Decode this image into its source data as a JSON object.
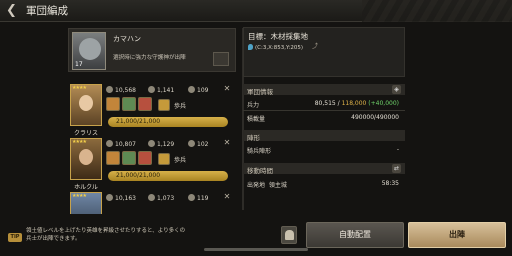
{
  "header": {
    "title": "軍団編成",
    "back_icon": "back-arrow-icon"
  },
  "commander": {
    "name": "カマハン",
    "level": "17",
    "description": "選択時に強力な守護神が出陣"
  },
  "heroes": [
    {
      "name": "クラリス",
      "stars": "★★★★",
      "troops": "10,568",
      "attack": "1,141",
      "count": "109",
      "unit_type": "歩兵",
      "power": "21,000/21,000",
      "power_fill": 1.0
    },
    {
      "name": "ホルクル",
      "stars": "★★★★",
      "troops": "10,807",
      "attack": "1,129",
      "count": "102",
      "unit_type": "歩兵",
      "power": "21,000/21,000",
      "power_fill": 1.0
    },
    {
      "name": "",
      "stars": "★★★★",
      "troops": "10,163",
      "attack": "1,073",
      "count": "119",
      "unit_type": "",
      "power": "",
      "power_fill": 0
    }
  ],
  "target": {
    "title": "目標：木材採集地",
    "coords": "(C:3,X:853,Y:205)"
  },
  "info": {
    "section_title": "軍団情報",
    "strength_label": "兵力",
    "strength_value": "80,515 /",
    "strength_max": "118,000",
    "strength_bonus": "(+40,000)",
    "capacity_label": "積載量",
    "capacity_value": "490000/490000"
  },
  "formation": {
    "section_title": "陣形",
    "type_label": "騎兵陣形",
    "type_value": "-"
  },
  "travel": {
    "section_title": "移動時間",
    "origin_label": "出発地",
    "origin_name": "領主城",
    "time": "58:35"
  },
  "tip": {
    "badge": "TIP",
    "text": "領土値レベルを上げたり英雄を昇級させたりすると、より多くの兵士が出陣できます。"
  },
  "buttons": {
    "auto": "自動配置",
    "go": "出陣"
  },
  "colors": {
    "gold": "#d7b14a",
    "accent_green": "#6fd36a",
    "accent_yellow": "#e0b44a"
  }
}
